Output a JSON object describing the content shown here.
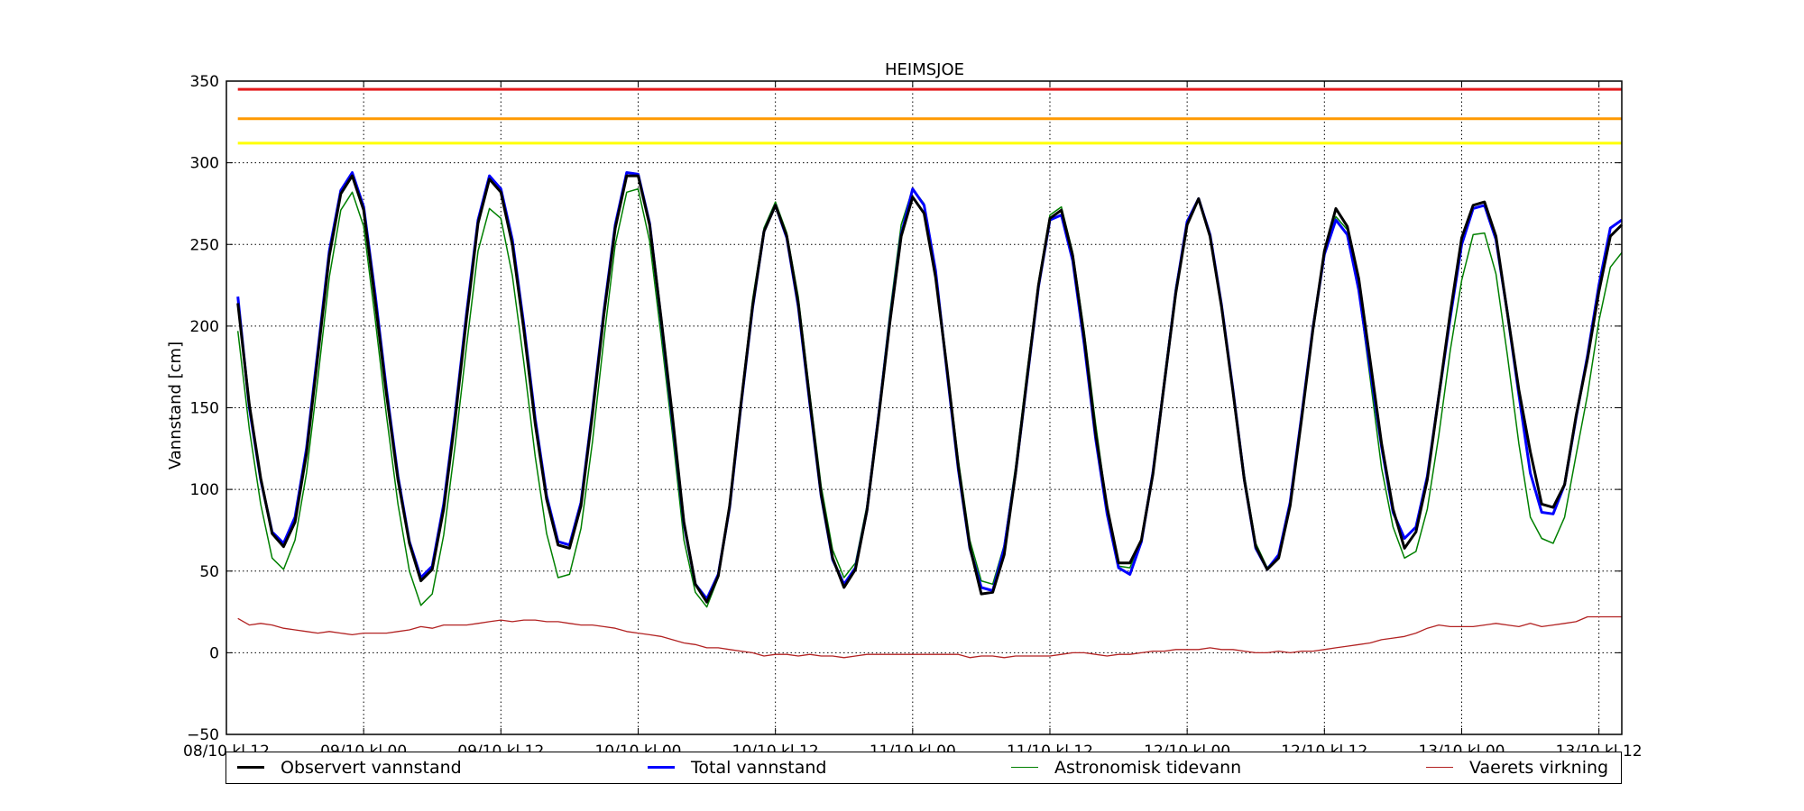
{
  "chart_data": {
    "type": "line",
    "title": "HEIMSJOE",
    "ylabel": "Vannstand [cm]",
    "xlabel": "",
    "ylim": [
      -50,
      350
    ],
    "yticks": [
      -50,
      0,
      50,
      100,
      150,
      200,
      250,
      300,
      350
    ],
    "xlim": [
      0,
      122
    ],
    "xticks": [
      {
        "pos": 0,
        "label": "08/10 kl 12"
      },
      {
        "pos": 12,
        "label": "09/10 kl 00"
      },
      {
        "pos": 24,
        "label": "09/10 kl 12"
      },
      {
        "pos": 36,
        "label": "10/10 kl 00"
      },
      {
        "pos": 48,
        "label": "10/10 kl 12"
      },
      {
        "pos": 60,
        "label": "11/10 kl 00"
      },
      {
        "pos": 72,
        "label": "11/10 kl 12"
      },
      {
        "pos": 84,
        "label": "12/10 kl 00"
      },
      {
        "pos": 96,
        "label": "12/10 kl 12"
      },
      {
        "pos": 108,
        "label": "13/10 kl 00"
      },
      {
        "pos": 120,
        "label": "13/10 kl 12"
      }
    ],
    "grid": true,
    "legend_position": "bottom",
    "thresholds": [
      {
        "value": 345,
        "color": "#e31a1c"
      },
      {
        "value": 327,
        "color": "#ff9900"
      },
      {
        "value": 312,
        "color": "#ffff00"
      }
    ],
    "series": [
      {
        "name": "Observert vannstand",
        "color": "#000000",
        "x": [
          1,
          2,
          3,
          4,
          5,
          6,
          7,
          8,
          9,
          10,
          11,
          12,
          13,
          14,
          15,
          16,
          17,
          18,
          19,
          20,
          21,
          22,
          23,
          24,
          25,
          26,
          27,
          28,
          29,
          30,
          31,
          32,
          33,
          34,
          35,
          36,
          37,
          38,
          39,
          40,
          41,
          42,
          43,
          44,
          45,
          46,
          47,
          48,
          49,
          50,
          51,
          52,
          53,
          54,
          55,
          56,
          57,
          58,
          59,
          60,
          61,
          62,
          63,
          64,
          65,
          66,
          67,
          68,
          69,
          70,
          71,
          72,
          73,
          74,
          75,
          76,
          77,
          78,
          79,
          80,
          81,
          82,
          83,
          84,
          85,
          86,
          87,
          88,
          89,
          90,
          91,
          92,
          93,
          94,
          95,
          96,
          97,
          98,
          99,
          100,
          101,
          102,
          103,
          104,
          105,
          106,
          107,
          108,
          109,
          110,
          111,
          112,
          113,
          114,
          115,
          116,
          117,
          118,
          119,
          120,
          121,
          122
        ],
        "y": [
          214,
          152,
          107,
          73,
          65,
          80,
          122,
          182,
          243,
          281,
          292,
          271,
          216,
          158,
          106,
          67,
          44,
          51,
          88,
          143,
          205,
          263,
          290,
          282,
          250,
          198,
          140,
          94,
          66,
          64,
          90,
          146,
          207,
          260,
          292,
          292,
          262,
          205,
          145,
          80,
          42,
          31,
          47,
          90,
          153,
          212,
          258,
          274,
          255,
          214,
          155,
          97,
          58,
          40,
          51,
          87,
          143,
          202,
          255,
          279,
          269,
          230,
          174,
          114,
          65,
          36,
          37,
          60,
          110,
          168,
          225,
          266,
          271,
          243,
          193,
          134,
          89,
          55,
          55,
          69,
          109,
          165,
          220,
          262,
          278,
          255,
          212,
          160,
          106,
          65,
          51,
          58,
          90,
          143,
          198,
          246,
          272,
          261,
          229,
          179,
          128,
          88,
          64,
          74,
          106,
          157,
          208,
          254,
          274,
          276,
          255,
          208,
          161,
          123,
          91,
          89,
          103,
          145,
          180,
          221,
          255,
          262
        ]
      },
      {
        "name": "Total vannstand",
        "color": "#0000ff",
        "x": [
          1,
          2,
          3,
          4,
          5,
          6,
          7,
          8,
          9,
          10,
          11,
          12,
          13,
          14,
          15,
          16,
          17,
          18,
          19,
          20,
          21,
          22,
          23,
          24,
          25,
          26,
          27,
          28,
          29,
          30,
          31,
          32,
          33,
          34,
          35,
          36,
          37,
          38,
          39,
          40,
          41,
          42,
          43,
          44,
          45,
          46,
          47,
          48,
          49,
          50,
          51,
          52,
          53,
          54,
          55,
          56,
          57,
          58,
          59,
          60,
          61,
          62,
          63,
          64,
          65,
          66,
          67,
          68,
          69,
          70,
          71,
          72,
          73,
          74,
          75,
          76,
          77,
          78,
          79,
          80,
          81,
          82,
          83,
          84,
          85,
          86,
          87,
          88,
          89,
          90,
          91,
          92,
          93,
          94,
          95,
          96,
          97,
          98,
          99,
          100,
          101,
          102,
          103,
          104,
          105,
          106,
          107,
          108,
          109,
          110,
          111,
          112,
          113,
          114,
          115,
          116,
          117,
          118,
          119,
          120,
          121,
          122
        ],
        "y": [
          218,
          150,
          106,
          74,
          67,
          83,
          125,
          185,
          246,
          283,
          294,
          273,
          220,
          161,
          108,
          68,
          46,
          53,
          91,
          146,
          208,
          265,
          292,
          284,
          253,
          201,
          143,
          96,
          68,
          66,
          92,
          148,
          209,
          262,
          294,
          293,
          263,
          204,
          143,
          79,
          42,
          33,
          48,
          89,
          152,
          211,
          258,
          274,
          254,
          212,
          153,
          96,
          57,
          42,
          52,
          87,
          144,
          203,
          256,
          284,
          274,
          234,
          172,
          112,
          64,
          40,
          38,
          64,
          110,
          167,
          224,
          265,
          268,
          240,
          189,
          131,
          85,
          52,
          48,
          68,
          110,
          165,
          221,
          264,
          278,
          256,
          213,
          161,
          106,
          64,
          51,
          60,
          92,
          145,
          199,
          244,
          265,
          256,
          222,
          174,
          126,
          86,
          70,
          77,
          108,
          157,
          205,
          250,
          272,
          274,
          253,
          208,
          158,
          110,
          86,
          85,
          103,
          144,
          182,
          225,
          260,
          265
        ]
      },
      {
        "name": "Astronomisk tidevann",
        "color": "#008000",
        "x": [
          1,
          2,
          3,
          4,
          5,
          6,
          7,
          8,
          9,
          10,
          11,
          12,
          13,
          14,
          15,
          16,
          17,
          18,
          19,
          20,
          21,
          22,
          23,
          24,
          25,
          26,
          27,
          28,
          29,
          30,
          31,
          32,
          33,
          34,
          35,
          36,
          37,
          38,
          39,
          40,
          41,
          42,
          43,
          44,
          45,
          46,
          47,
          48,
          49,
          50,
          51,
          52,
          53,
          54,
          55,
          56,
          57,
          58,
          59,
          60,
          61,
          62,
          63,
          64,
          65,
          66,
          67,
          68,
          69,
          70,
          71,
          72,
          73,
          74,
          75,
          76,
          77,
          78,
          79,
          80,
          81,
          82,
          83,
          84,
          85,
          86,
          87,
          88,
          89,
          90,
          91,
          92,
          93,
          94,
          95,
          96,
          97,
          98,
          99,
          100,
          101,
          102,
          103,
          104,
          105,
          106,
          107,
          108,
          109,
          110,
          111,
          112,
          113,
          114,
          115,
          116,
          117,
          118,
          119,
          120,
          121,
          122
        ],
        "y": [
          197,
          137,
          91,
          58,
          51,
          69,
          110,
          168,
          230,
          271,
          282,
          261,
          205,
          145,
          91,
          50,
          29,
          36,
          72,
          127,
          188,
          246,
          272,
          266,
          231,
          178,
          120,
          73,
          46,
          48,
          76,
          129,
          192,
          250,
          282,
          284,
          252,
          194,
          134,
          69,
          37,
          28,
          46,
          90,
          155,
          216,
          260,
          276,
          257,
          218,
          159,
          102,
          63,
          46,
          55,
          90,
          147,
          208,
          262,
          284,
          275,
          235,
          176,
          118,
          69,
          44,
          42,
          66,
          114,
          172,
          227,
          268,
          273,
          245,
          197,
          140,
          89,
          53,
          52,
          70,
          112,
          168,
          224,
          263,
          278,
          257,
          214,
          162,
          109,
          67,
          52,
          60,
          93,
          147,
          201,
          245,
          267,
          259,
          221,
          168,
          113,
          77,
          58,
          62,
          88,
          133,
          185,
          228,
          256,
          257,
          232,
          182,
          128,
          83,
          70,
          67,
          83,
          121,
          158,
          203,
          236,
          245
        ]
      },
      {
        "name": "Vaerets virkning",
        "color": "#b22222",
        "x": [
          1,
          2,
          3,
          4,
          5,
          6,
          7,
          8,
          9,
          10,
          11,
          12,
          13,
          14,
          15,
          16,
          17,
          18,
          19,
          20,
          21,
          22,
          23,
          24,
          25,
          26,
          27,
          28,
          29,
          30,
          31,
          32,
          33,
          34,
          35,
          36,
          37,
          38,
          39,
          40,
          41,
          42,
          43,
          44,
          45,
          46,
          47,
          48,
          49,
          50,
          51,
          52,
          53,
          54,
          55,
          56,
          57,
          58,
          59,
          60,
          61,
          62,
          63,
          64,
          65,
          66,
          67,
          68,
          69,
          70,
          71,
          72,
          73,
          74,
          75,
          76,
          77,
          78,
          79,
          80,
          81,
          82,
          83,
          84,
          85,
          86,
          87,
          88,
          89,
          90,
          91,
          92,
          93,
          94,
          95,
          96,
          97,
          98,
          99,
          100,
          101,
          102,
          103,
          104,
          105,
          106,
          107,
          108,
          109,
          110,
          111,
          112,
          113,
          114,
          115,
          116,
          117,
          118,
          119,
          120,
          121,
          122
        ],
        "y": [
          21,
          17,
          18,
          17,
          15,
          14,
          13,
          12,
          13,
          12,
          11,
          12,
          12,
          12,
          13,
          14,
          16,
          15,
          17,
          17,
          17,
          18,
          19,
          20,
          19,
          20,
          20,
          19,
          19,
          18,
          17,
          17,
          16,
          15,
          13,
          12,
          11,
          10,
          8,
          6,
          5,
          3,
          3,
          2,
          1,
          0,
          -2,
          -1,
          -1,
          -2,
          -1,
          -2,
          -2,
          -3,
          -2,
          -1,
          -1,
          -1,
          -1,
          -1,
          -1,
          -1,
          -1,
          -1,
          -3,
          -2,
          -2,
          -3,
          -2,
          -2,
          -2,
          -2,
          -1,
          0,
          0,
          -1,
          -2,
          -1,
          -1,
          0,
          1,
          1,
          2,
          2,
          2,
          3,
          2,
          2,
          1,
          0,
          0,
          1,
          0,
          1,
          1,
          2,
          3,
          4,
          5,
          6,
          8,
          9,
          10,
          12,
          15,
          17,
          16,
          16,
          16,
          17,
          18,
          17,
          16,
          18,
          16,
          17,
          18,
          19,
          22,
          22,
          22,
          22
        ]
      }
    ]
  }
}
